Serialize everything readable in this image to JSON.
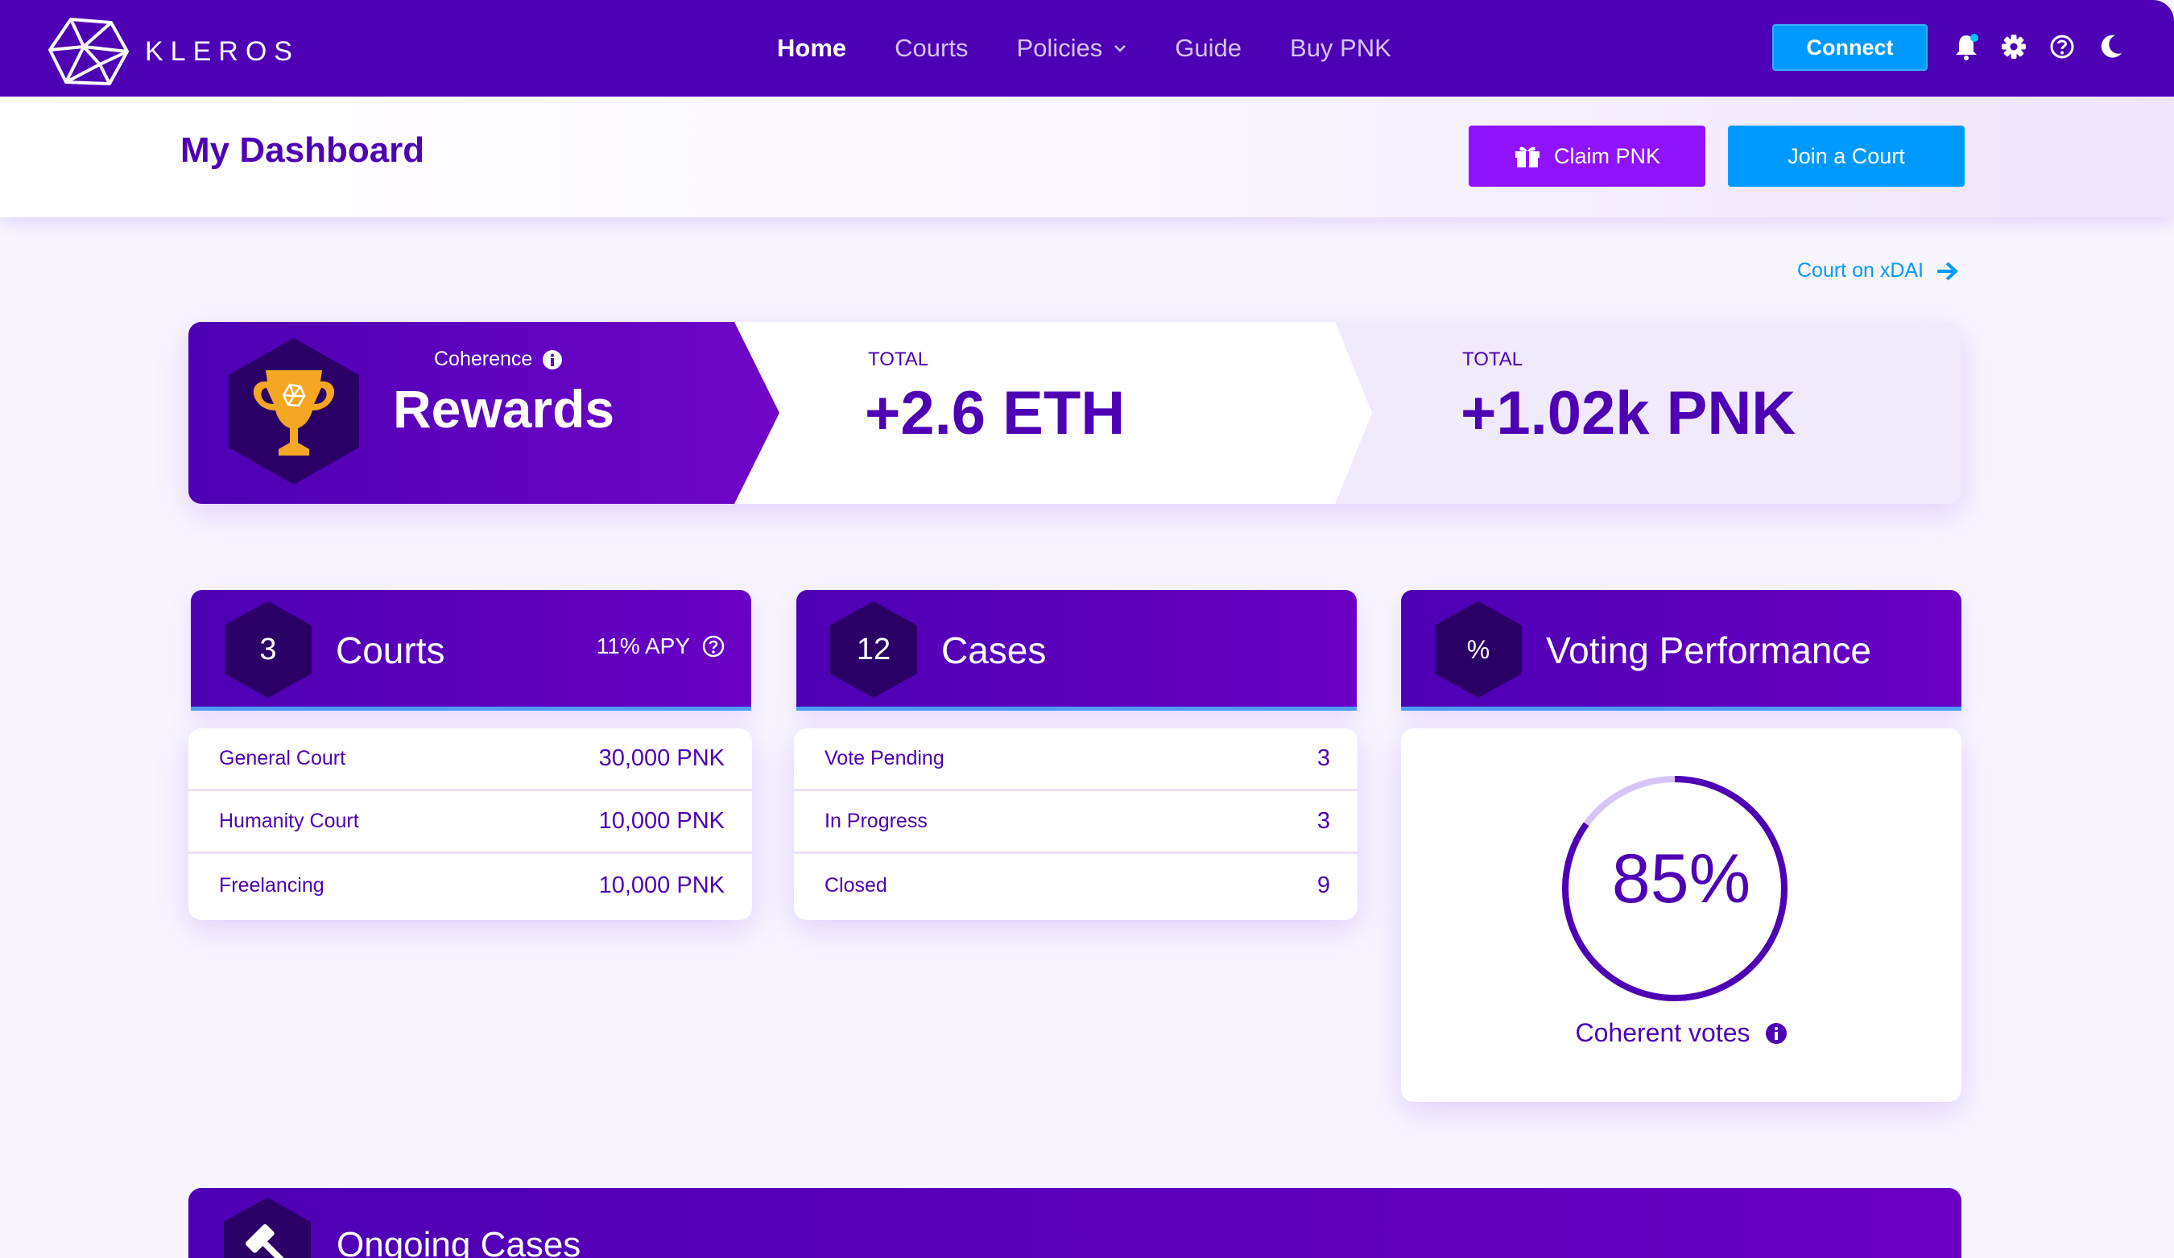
{
  "brand": {
    "name": "KLEROS",
    "logo_icon": "kleros-logo-icon"
  },
  "nav": {
    "links": [
      {
        "label": "Home",
        "active": true
      },
      {
        "label": "Courts",
        "active": false
      },
      {
        "label": "Policies",
        "active": false,
        "has_dropdown": true
      },
      {
        "label": "Guide",
        "active": false
      },
      {
        "label": "Buy PNK",
        "active": false
      }
    ],
    "connect_label": "Connect",
    "icons": [
      "bell-icon",
      "gear-icon",
      "help-icon",
      "moon-icon"
    ]
  },
  "header": {
    "title": "My Dashboard",
    "claim_label": "Claim PNK",
    "join_label": "Join a Court"
  },
  "xdai_link": "Court on xDAI",
  "rewards": {
    "coherence_label": "Coherence",
    "title": "Rewards",
    "eth_label": "TOTAL",
    "eth_value": "+2.6 ETH",
    "pnk_label": "TOTAL",
    "pnk_value": "+1.02k PNK"
  },
  "courts": {
    "count": "3",
    "title": "Courts",
    "apy": "11% APY",
    "rows": [
      {
        "label": "General Court",
        "value": "30,000 PNK"
      },
      {
        "label": "Humanity Court",
        "value": "10,000 PNK"
      },
      {
        "label": "Freelancing",
        "value": "10,000 PNK"
      }
    ]
  },
  "cases": {
    "count": "12",
    "title": "Cases",
    "rows": [
      {
        "label": "Vote Pending",
        "value": "3"
      },
      {
        "label": "In Progress",
        "value": "3"
      },
      {
        "label": "Closed",
        "value": "9"
      }
    ]
  },
  "voting": {
    "symbol": "%",
    "title": "Voting Performance",
    "percent_label": "85%",
    "percent_value": 0.85,
    "caption": "Coherent votes"
  },
  "ongoing": {
    "title": "Ongoing Cases"
  },
  "colors": {
    "primary": "#4d00b4",
    "accent_blue": "#009aff",
    "claim_purple": "#9013fe",
    "trophy_gold": "#f5a623"
  }
}
